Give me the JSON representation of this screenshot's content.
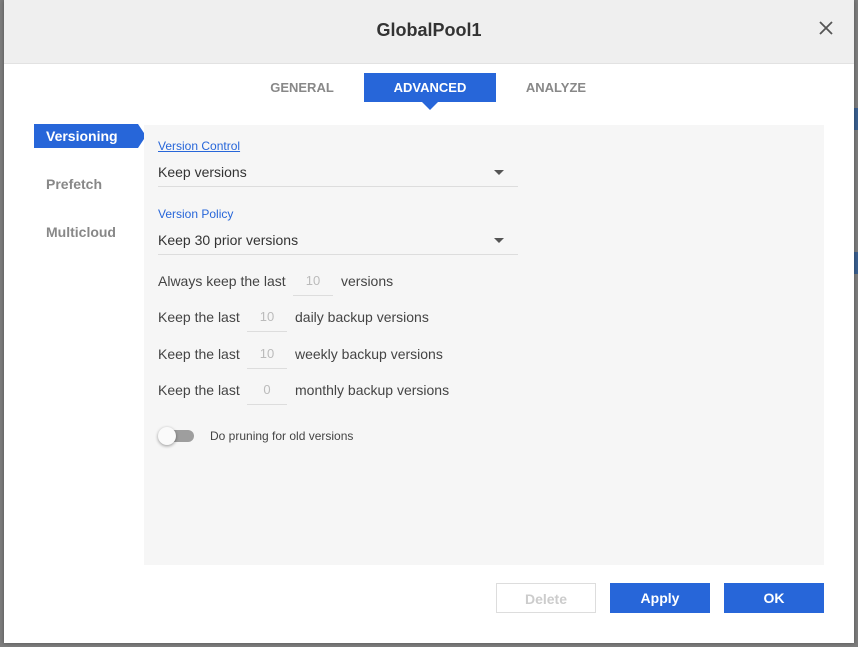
{
  "dialog": {
    "title": "GlobalPool1"
  },
  "tabs": [
    {
      "label": "GENERAL",
      "active": false
    },
    {
      "label": "ADVANCED",
      "active": true
    },
    {
      "label": "ANALYZE",
      "active": false
    }
  ],
  "sidebar": {
    "items": [
      {
        "label": "Versioning",
        "active": true
      },
      {
        "label": "Prefetch",
        "active": false
      },
      {
        "label": "Multicloud",
        "active": false
      }
    ]
  },
  "versioning": {
    "version_control": {
      "label": "Version Control",
      "value": "Keep versions"
    },
    "version_policy": {
      "label": "Version Policy",
      "value": "Keep 30 prior versions"
    },
    "always_keep": {
      "prefix": "Always keep the last",
      "value": "10",
      "suffix": "versions"
    },
    "daily": {
      "prefix": "Keep the last",
      "value": "10",
      "suffix": "daily backup versions"
    },
    "weekly": {
      "prefix": "Keep the last",
      "value": "10",
      "suffix": "weekly backup versions"
    },
    "monthly": {
      "prefix": "Keep the last",
      "value": "0",
      "suffix": "monthly backup versions"
    },
    "pruning": {
      "label": "Do pruning for old versions",
      "enabled": false
    }
  },
  "footer": {
    "delete_label": "Delete",
    "apply_label": "Apply",
    "ok_label": "OK"
  },
  "colors": {
    "accent": "#2766d9",
    "panel_bg": "#f6f6f6",
    "titlebar_bg": "#efefef"
  },
  "icons": {
    "close": "close-icon",
    "dropdown": "caret-down-icon"
  }
}
